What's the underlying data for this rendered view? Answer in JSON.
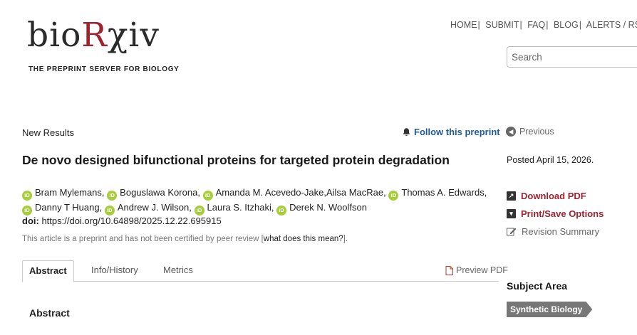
{
  "header": {
    "logo": {
      "pre": "bio",
      "mid": "R",
      "post": "χiv",
      "tagline": "THE PREPRINT SERVER FOR BIOLOGY"
    },
    "nav": [
      "HOME",
      "SUBMIT",
      "FAQ",
      "BLOG",
      "ALERTS / RSS"
    ],
    "search_placeholder": "Search"
  },
  "article": {
    "section": "New Results",
    "follow_label": "Follow this preprint",
    "title": "De novo designed bifunctional proteins for targeted protein degradation",
    "authors": [
      {
        "name": "Bram Mylemans",
        "orcid": true
      },
      {
        "name": "Boguslawa Korona",
        "orcid": true
      },
      {
        "name": "Amanda M. Acevedo-Jake",
        "orcid": true
      },
      {
        "name": "Ailsa MacRae",
        "orcid": false
      },
      {
        "name": "Thomas A. Edwards",
        "orcid": true
      },
      {
        "name": "Danny T Huang",
        "orcid": true
      },
      {
        "name": "Andrew J. Wilson",
        "orcid": true
      },
      {
        "name": "Laura S. Itzhaki",
        "orcid": true
      },
      {
        "name": "Derek N. Woolfson",
        "orcid": true
      }
    ],
    "doi_label": "doi:",
    "doi": "https://doi.org/10.64898/2025.12.22.695915",
    "notice_pre": "This article is a preprint and has not been certified by peer review [",
    "notice_link": "what does this mean?",
    "notice_post": "]."
  },
  "tabs": {
    "items": [
      "Abstract",
      "Info/History",
      "Metrics"
    ],
    "active": "Abstract",
    "preview_pdf": "Preview PDF"
  },
  "body": {
    "abstract_heading": "Abstract"
  },
  "sidebar": {
    "previous": "Previous",
    "posted": "Posted April 15, 2026.",
    "download_pdf": "Download PDF",
    "print_save": "Print/Save Options",
    "revision_summary": "Revision Summary",
    "subject_heading": "Subject Area",
    "subject_tag": "Synthetic Biology"
  },
  "colors": {
    "brand_red": "#a1222f",
    "link_blue": "#1e5a99",
    "orcid_green": "#a6ce39"
  },
  "icons": [
    "bell-icon",
    "orcid-icon",
    "pdf-file-icon",
    "previous-arrow-icon",
    "external-link-icon",
    "dropdown-box-icon",
    "edit-icon"
  ]
}
